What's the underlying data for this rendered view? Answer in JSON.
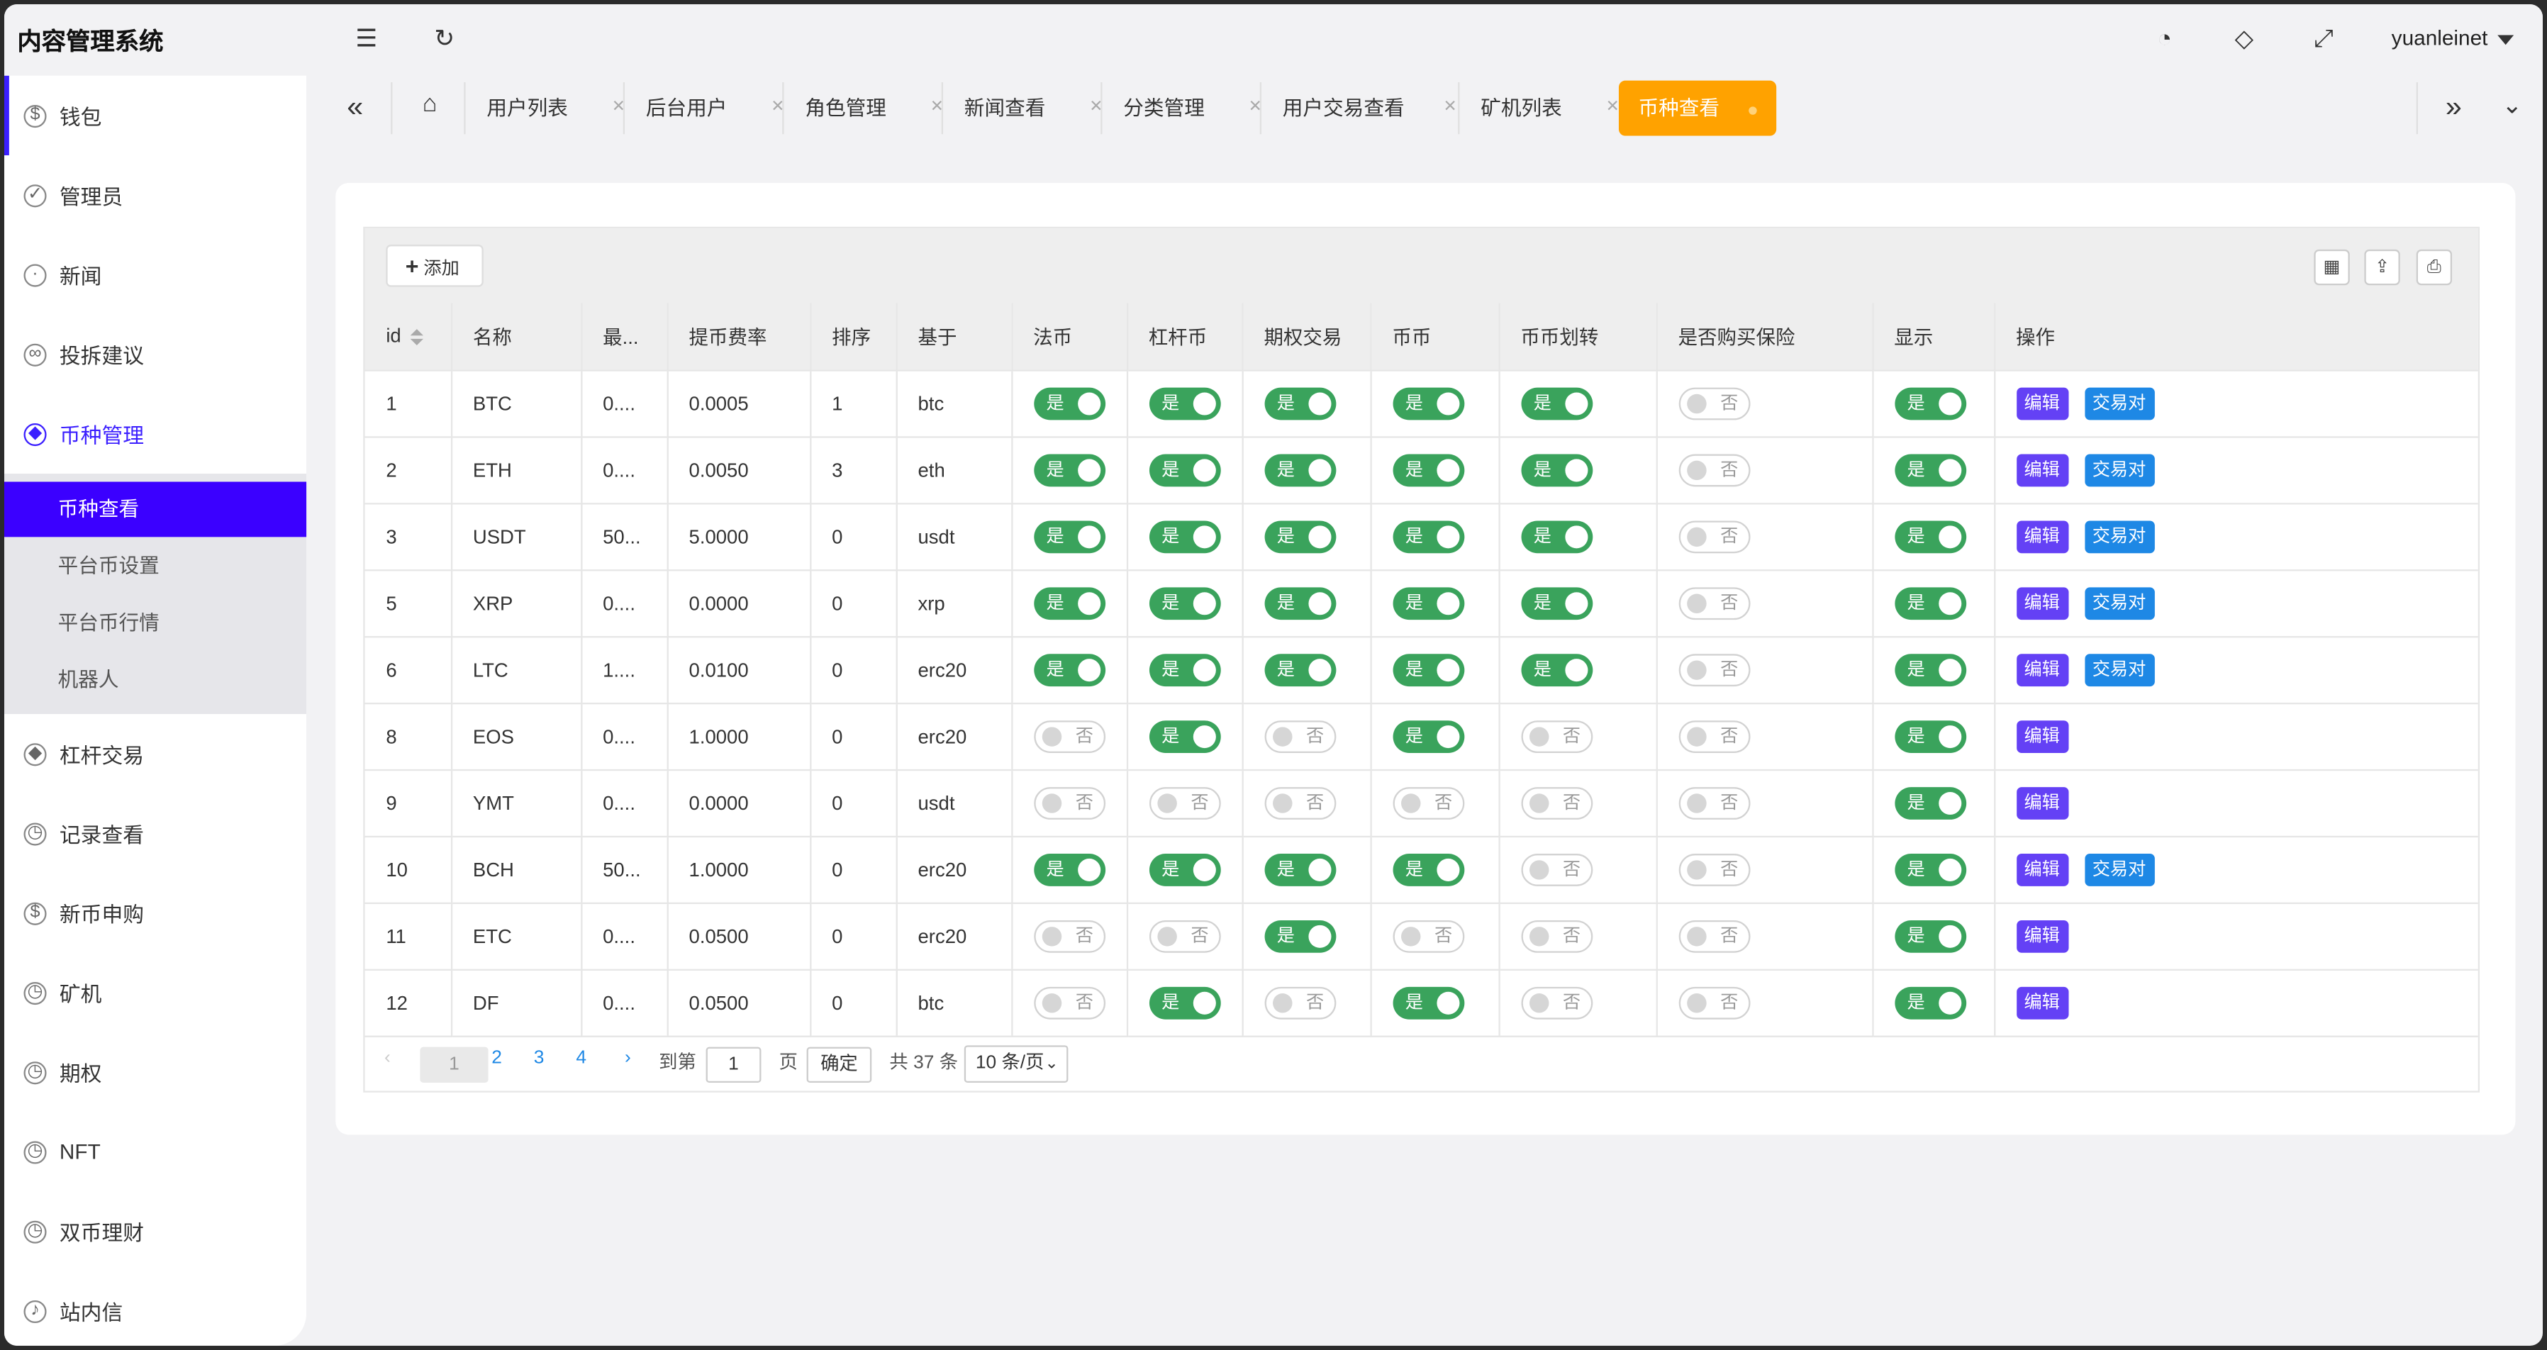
{
  "app": {
    "title": "内容管理系统",
    "username": "yuanleinet"
  },
  "sidebar": {
    "items": [
      {
        "label": "钱包",
        "icon": "dollar-icon"
      },
      {
        "label": "管理员",
        "icon": "shield-icon"
      },
      {
        "label": "新闻",
        "icon": "tag-icon"
      },
      {
        "label": "投拆建议",
        "icon": "infinity-icon"
      },
      {
        "label": "币种管理",
        "icon": "diamond-icon"
      },
      {
        "label": "杠杆交易",
        "icon": "diamond-icon"
      },
      {
        "label": "记录查看",
        "icon": "history-icon"
      },
      {
        "label": "新币申购",
        "icon": "dollar-icon"
      },
      {
        "label": "矿机",
        "icon": "history-icon"
      },
      {
        "label": "期权",
        "icon": "history-icon"
      },
      {
        "label": "NFT",
        "icon": "history-icon"
      },
      {
        "label": "双币理财",
        "icon": "history-icon"
      },
      {
        "label": "站内信",
        "icon": "bell-icon"
      }
    ],
    "submenu": [
      {
        "label": "币种查看"
      },
      {
        "label": "平台币设置"
      },
      {
        "label": "平台币行情"
      },
      {
        "label": "机器人"
      }
    ]
  },
  "tabs": [
    {
      "label": "用户列表"
    },
    {
      "label": "后台用户"
    },
    {
      "label": "角色管理"
    },
    {
      "label": "新闻查看"
    },
    {
      "label": "分类管理"
    },
    {
      "label": "用户交易查看"
    },
    {
      "label": "矿机列表"
    },
    {
      "label": "币种查看"
    }
  ],
  "toolbar": {
    "add_label": "添加"
  },
  "table": {
    "headers": [
      "id",
      "名称",
      "最...",
      "提币费率",
      "排序",
      "基于",
      "法币",
      "杠杆币",
      "期权交易",
      "币币",
      "币币划转",
      "是否购买保险",
      "显示",
      "操作"
    ],
    "on_label": "是",
    "off_label": "否",
    "edit_label": "编辑",
    "pair_label": "交易对",
    "rows": [
      {
        "id": "1",
        "name": "BTC",
        "min": "0....",
        "fee": "0.0005",
        "sort": "1",
        "base": "btc",
        "fiat": true,
        "lever": true,
        "option": true,
        "coin": true,
        "transfer": true,
        "insurance": false,
        "show": true,
        "pair": true
      },
      {
        "id": "2",
        "name": "ETH",
        "min": "0....",
        "fee": "0.0050",
        "sort": "3",
        "base": "eth",
        "fiat": true,
        "lever": true,
        "option": true,
        "coin": true,
        "transfer": true,
        "insurance": false,
        "show": true,
        "pair": true
      },
      {
        "id": "3",
        "name": "USDT",
        "min": "50...",
        "fee": "5.0000",
        "sort": "0",
        "base": "usdt",
        "fiat": true,
        "lever": true,
        "option": true,
        "coin": true,
        "transfer": true,
        "insurance": false,
        "show": true,
        "pair": true
      },
      {
        "id": "5",
        "name": "XRP",
        "min": "0....",
        "fee": "0.0000",
        "sort": "0",
        "base": "xrp",
        "fiat": true,
        "lever": true,
        "option": true,
        "coin": true,
        "transfer": true,
        "insurance": false,
        "show": true,
        "pair": true
      },
      {
        "id": "6",
        "name": "LTC",
        "min": "1....",
        "fee": "0.0100",
        "sort": "0",
        "base": "erc20",
        "fiat": true,
        "lever": true,
        "option": true,
        "coin": true,
        "transfer": true,
        "insurance": false,
        "show": true,
        "pair": true
      },
      {
        "id": "8",
        "name": "EOS",
        "min": "0....",
        "fee": "1.0000",
        "sort": "0",
        "base": "erc20",
        "fiat": false,
        "lever": true,
        "option": false,
        "coin": true,
        "transfer": false,
        "insurance": false,
        "show": true,
        "pair": false
      },
      {
        "id": "9",
        "name": "YMT",
        "min": "0....",
        "fee": "0.0000",
        "sort": "0",
        "base": "usdt",
        "fiat": false,
        "lever": false,
        "option": false,
        "coin": false,
        "transfer": false,
        "insurance": false,
        "show": true,
        "pair": false
      },
      {
        "id": "10",
        "name": "BCH",
        "min": "50...",
        "fee": "1.0000",
        "sort": "0",
        "base": "erc20",
        "fiat": true,
        "lever": true,
        "option": true,
        "coin": true,
        "transfer": false,
        "insurance": false,
        "show": true,
        "pair": true
      },
      {
        "id": "11",
        "name": "ETC",
        "min": "0....",
        "fee": "0.0500",
        "sort": "0",
        "base": "erc20",
        "fiat": false,
        "lever": false,
        "option": true,
        "coin": false,
        "transfer": false,
        "insurance": false,
        "show": true,
        "pair": false
      },
      {
        "id": "12",
        "name": "DF",
        "min": "0....",
        "fee": "0.0500",
        "sort": "0",
        "base": "btc",
        "fiat": false,
        "lever": true,
        "option": false,
        "coin": true,
        "transfer": false,
        "insurance": false,
        "show": true,
        "pair": false
      }
    ]
  },
  "pagination": {
    "current": "1",
    "pages": [
      "2",
      "3",
      "4"
    ],
    "goto_label": "到第",
    "goto_value": "1",
    "page_unit": "页",
    "confirm_label": "确定",
    "total": "共 37 条",
    "page_size": "10 条/页"
  },
  "colors": {
    "primary": "#3b00ff",
    "active_tab": "#ffa200",
    "switch_on": "#3aa35c",
    "edit": "#6441f5",
    "pair": "#1e88e5"
  }
}
